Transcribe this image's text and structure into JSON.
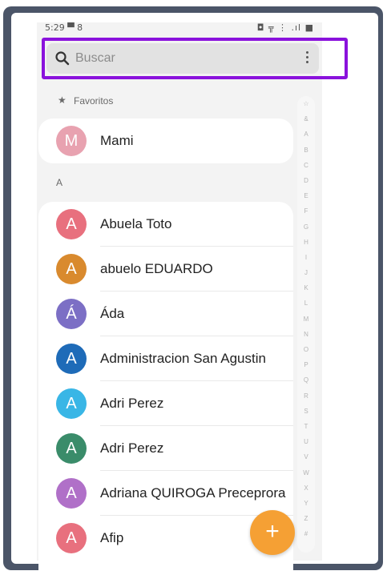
{
  "status_bar": {
    "time": "5:29",
    "left_extra": "▀ 8",
    "right_icons": "◘ ╦ ⋮ .ıl ■"
  },
  "search": {
    "placeholder": "Buscar"
  },
  "favorites": {
    "label": "Favoritos",
    "items": [
      {
        "initial": "M",
        "name": "Mami",
        "color": "#e8a2b0"
      }
    ]
  },
  "section": {
    "letter": "A"
  },
  "contacts": [
    {
      "initial": "A",
      "name": "Abuela Toto",
      "color": "#e8707e"
    },
    {
      "initial": "A",
      "name": "abuelo EDUARDO",
      "color": "#d98a2e"
    },
    {
      "initial": "Á",
      "name": "Áda",
      "color": "#7c6fc5"
    },
    {
      "initial": "A",
      "name": "Administracion San Agustin",
      "color": "#1e6bb8"
    },
    {
      "initial": "A",
      "name": "Adri Perez",
      "color": "#39b6e6"
    },
    {
      "initial": "A",
      "name": "Adri Perez",
      "color": "#3a8c6a"
    },
    {
      "initial": "A",
      "name": "Adriana QUIROGA Preceprora",
      "color": "#b070c8"
    },
    {
      "initial": "A",
      "name": "Afip",
      "color": "#e8707e"
    }
  ],
  "index_letters": [
    "☆",
    "&",
    "A",
    "B",
    "C",
    "D",
    "E",
    "F",
    "G",
    "H",
    "I",
    "J",
    "K",
    "L",
    "M",
    "N",
    "O",
    "P",
    "Q",
    "R",
    "S",
    "T",
    "U",
    "V",
    "W",
    "X",
    "Y",
    "Z",
    "#"
  ],
  "fab": {
    "label": "+",
    "color": "#f5a034"
  },
  "highlight_color": "#8a12dc"
}
